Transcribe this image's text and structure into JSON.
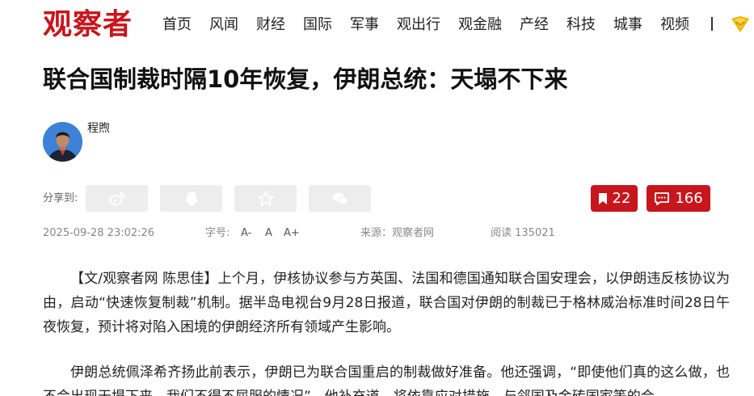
{
  "site": {
    "logo_text": "观察者"
  },
  "nav": {
    "items": [
      "首页",
      "风闻",
      "财经",
      "国际",
      "军事",
      "观出行",
      "观金融",
      "产经",
      "科技",
      "城事",
      "视频"
    ],
    "separator": "|"
  },
  "article": {
    "title": "联合国制裁时隔10年恢复，伊朗总统：天塌不下来",
    "author": "程煦",
    "share_label": "分享到:",
    "bookmark_count": "22",
    "comment_count": "166",
    "datetime": "2025-09-28 23:02:26",
    "font_size_label": "字号:",
    "font_size_options": [
      "A-",
      "A",
      "A+"
    ],
    "source": "来源：观察者网",
    "reads": "阅读 135021",
    "paragraphs": [
      "【文/观察者网 陈思佳】上个月，伊核协议参与方英国、法国和德国通知联合国安理会，以伊朗违反核协议为由，启动“快速恢复制裁”机制。据半岛电视台9月28日报道，联合国对伊朗的制裁已于格林威治标准时间28日午夜恢复，预计将对陷入困境的伊朗经济所有领域产生影响。",
      "伊朗总统佩泽希齐扬此前表示，伊朗已为联合国重启的制裁做好准备。他还强调，“即使他们真的这么做，也不会出现天塌下来、我们不得不屈服的情况”。他补充道，将依靠应对措施，与邻国及金砖国家等的合"
    ]
  },
  "colors": {
    "brand_red": "#c8161d",
    "share_bg": "#ededed"
  },
  "icons": [
    "weibo-icon",
    "qq-icon",
    "qzone-star-icon",
    "wechat-icon",
    "bookmark-icon",
    "comment-icon",
    "vip-badge-icon"
  ]
}
